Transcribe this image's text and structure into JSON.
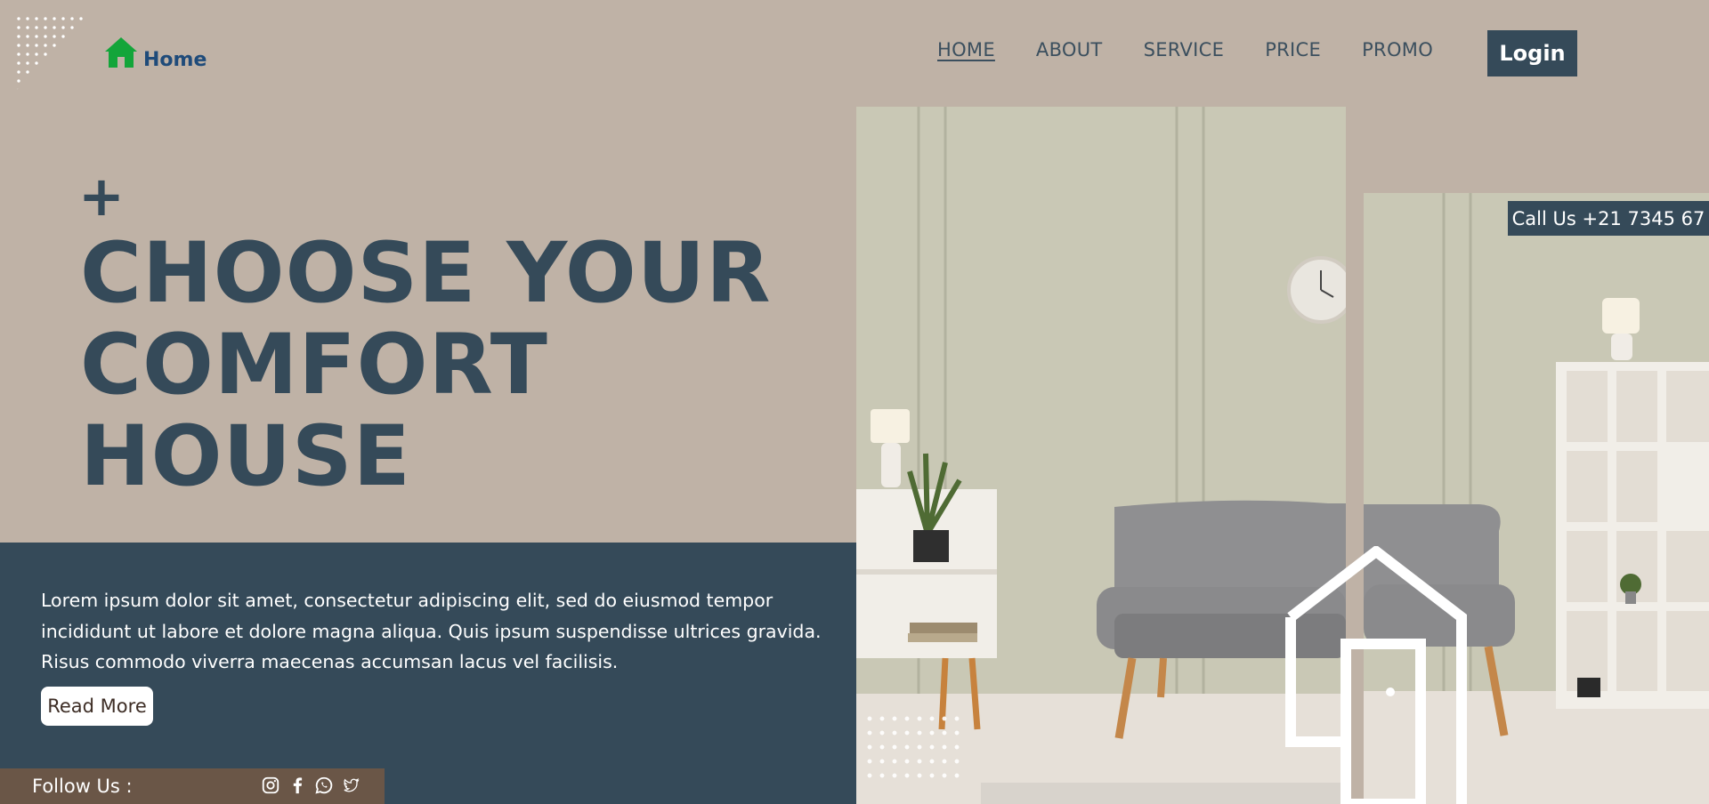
{
  "brand": {
    "name": "Home",
    "icon": "house-icon",
    "icon_color": "#13a53a",
    "text_color": "#1f4b7a"
  },
  "nav": {
    "items": [
      {
        "label": "HOME",
        "active": true
      },
      {
        "label": "ABOUT",
        "active": false
      },
      {
        "label": "SERVICE",
        "active": false
      },
      {
        "label": "PRICE",
        "active": false
      },
      {
        "label": "PROMO",
        "active": false
      }
    ],
    "login_label": "Login"
  },
  "hero": {
    "plus": "+",
    "headline": [
      "CHOOSE YOUR",
      "COMFORT",
      "HOUSE"
    ],
    "description": "Lorem ipsum dolor sit amet, consectetur adipiscing elit, sed do eiusmod tempor incididunt ut labore et dolore magna aliqua. Quis ipsum suspendisse ultrices gravida. Risus commodo viverra maecenas accumsan lacus vel facilisis.",
    "read_more": "Read More"
  },
  "contact": {
    "call_us": "Call Us +21 7345 67"
  },
  "social": {
    "label": "Follow Us :",
    "icons": [
      "instagram-icon",
      "facebook-icon",
      "whatsapp-icon",
      "twitter-icon"
    ]
  },
  "colors": {
    "background": "#bfb2a6",
    "accent": "#354a59",
    "follow_bar": "#6a5647",
    "wall": "#c9c8b5",
    "sofa": "#8e8e90"
  }
}
